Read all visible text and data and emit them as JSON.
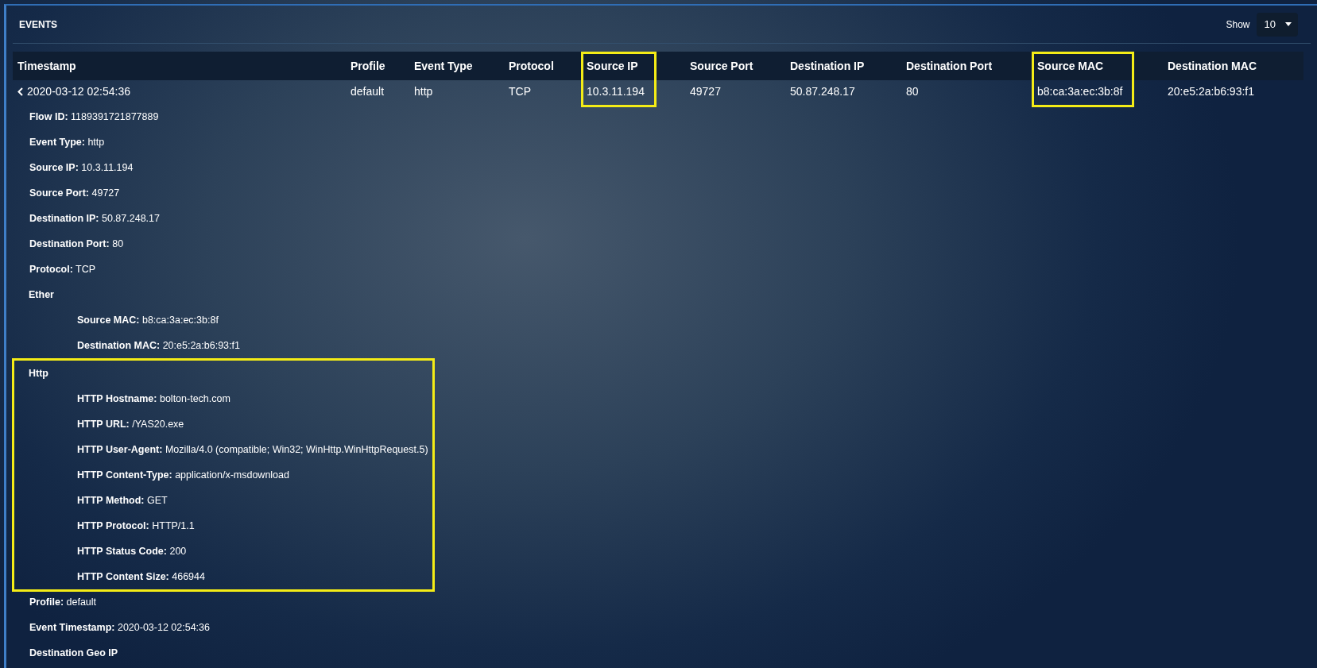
{
  "panel": {
    "title": "EVENTS",
    "show_label": "Show",
    "page_size": "10"
  },
  "table": {
    "columns": [
      {
        "label": "Timestamp",
        "highlighted": false
      },
      {
        "label": "Profile",
        "highlighted": false
      },
      {
        "label": "Event Type",
        "highlighted": false
      },
      {
        "label": "Protocol",
        "highlighted": false
      },
      {
        "label": "Source IP",
        "highlighted": true
      },
      {
        "label": "Source Port",
        "highlighted": false
      },
      {
        "label": "Destination IP",
        "highlighted": false
      },
      {
        "label": "Destination Port",
        "highlighted": false
      },
      {
        "label": "Source MAC",
        "highlighted": true
      },
      {
        "label": "Destination MAC",
        "highlighted": false
      }
    ],
    "rows": [
      {
        "expanded": true,
        "cells": [
          "2020-03-12 02:54:36",
          "default",
          "http",
          "TCP",
          "10.3.11.194",
          "49727",
          "50.87.248.17",
          "80",
          "b8:ca:3a:ec:3b:8f",
          "20:e5:2a:b6:93:f1"
        ],
        "details": [
          {
            "label": "Flow ID:",
            "value": "1189391721877889"
          },
          {
            "label": "Event Type:",
            "value": "http"
          },
          {
            "label": "Source IP:",
            "value": "10.3.11.194"
          },
          {
            "label": "Source Port:",
            "value": "49727"
          },
          {
            "label": "Destination IP:",
            "value": "50.87.248.17"
          },
          {
            "label": "Destination Port:",
            "value": "80"
          },
          {
            "label": "Protocol:",
            "value": "TCP"
          },
          {
            "label": "Ether",
            "highlighted": false,
            "children": [
              {
                "label": "Source MAC:",
                "value": "b8:ca:3a:ec:3b:8f"
              },
              {
                "label": "Destination MAC:",
                "value": "20:e5:2a:b6:93:f1"
              }
            ]
          },
          {
            "label": "Http",
            "highlighted": true,
            "children": [
              {
                "label": "HTTP Hostname:",
                "value": "bolton-tech.com"
              },
              {
                "label": "HTTP URL:",
                "value": "/YAS20.exe"
              },
              {
                "label": "HTTP User-Agent:",
                "value": "Mozilla/4.0 (compatible; Win32; WinHttp.WinHttpRequest.5)"
              },
              {
                "label": "HTTP Content-Type:",
                "value": "application/x-msdownload"
              },
              {
                "label": "HTTP Method:",
                "value": "GET"
              },
              {
                "label": "HTTP Protocol:",
                "value": "HTTP/1.1"
              },
              {
                "label": "HTTP Status Code:",
                "value": "200"
              },
              {
                "label": "HTTP Content Size:",
                "value": "466944"
              }
            ]
          },
          {
            "label": "Profile:",
            "value": "default"
          },
          {
            "label": "Event Timestamp:",
            "value": "2020-03-12 02:54:36"
          },
          {
            "label": "Destination Geo IP"
          }
        ]
      }
    ]
  }
}
